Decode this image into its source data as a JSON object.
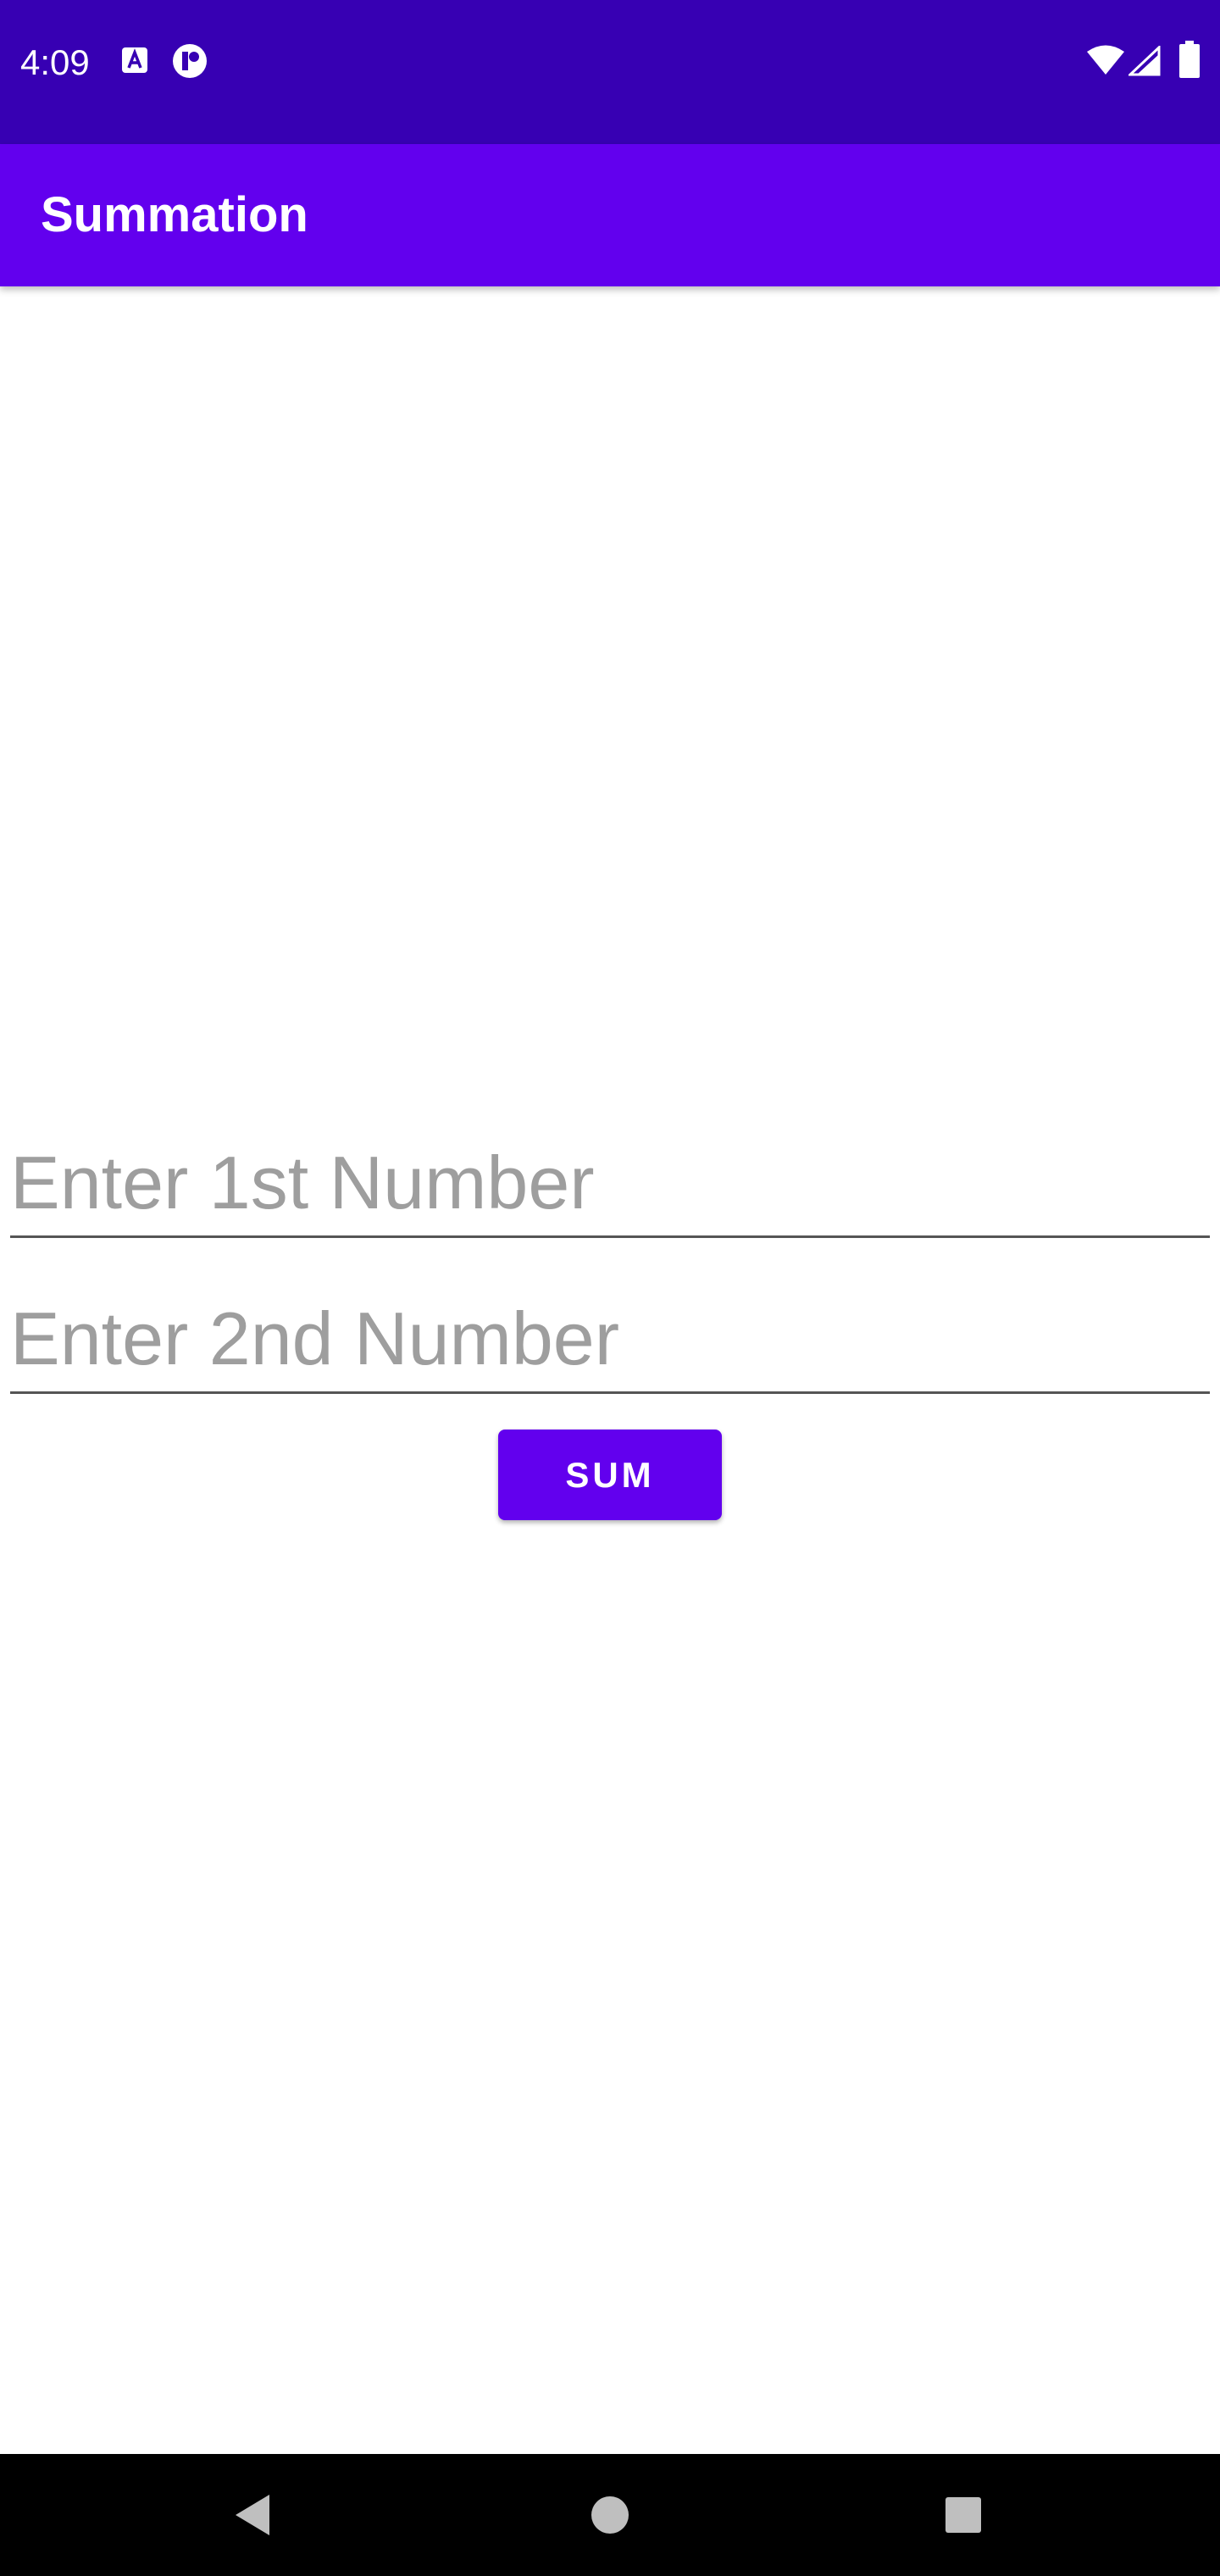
{
  "status_bar": {
    "time": "4:09",
    "left_icons": [
      "a-badge-icon",
      "app-notification-icon"
    ],
    "right_icons": [
      "wifi-icon",
      "cellular-signal-icon",
      "battery-icon"
    ]
  },
  "app_bar": {
    "title": "Summation"
  },
  "form": {
    "first_number": {
      "value": "",
      "placeholder": "Enter 1st Number"
    },
    "second_number": {
      "value": "",
      "placeholder": "Enter 2nd Number"
    },
    "sum_button_label": "SUM"
  },
  "navigation_bar": {
    "buttons": [
      "back-icon",
      "home-icon",
      "recents-icon"
    ]
  },
  "colors": {
    "status_bar": "#3700b3",
    "primary": "#6200ee",
    "background": "#ffffff",
    "hint_text": "#9e9e9e"
  }
}
